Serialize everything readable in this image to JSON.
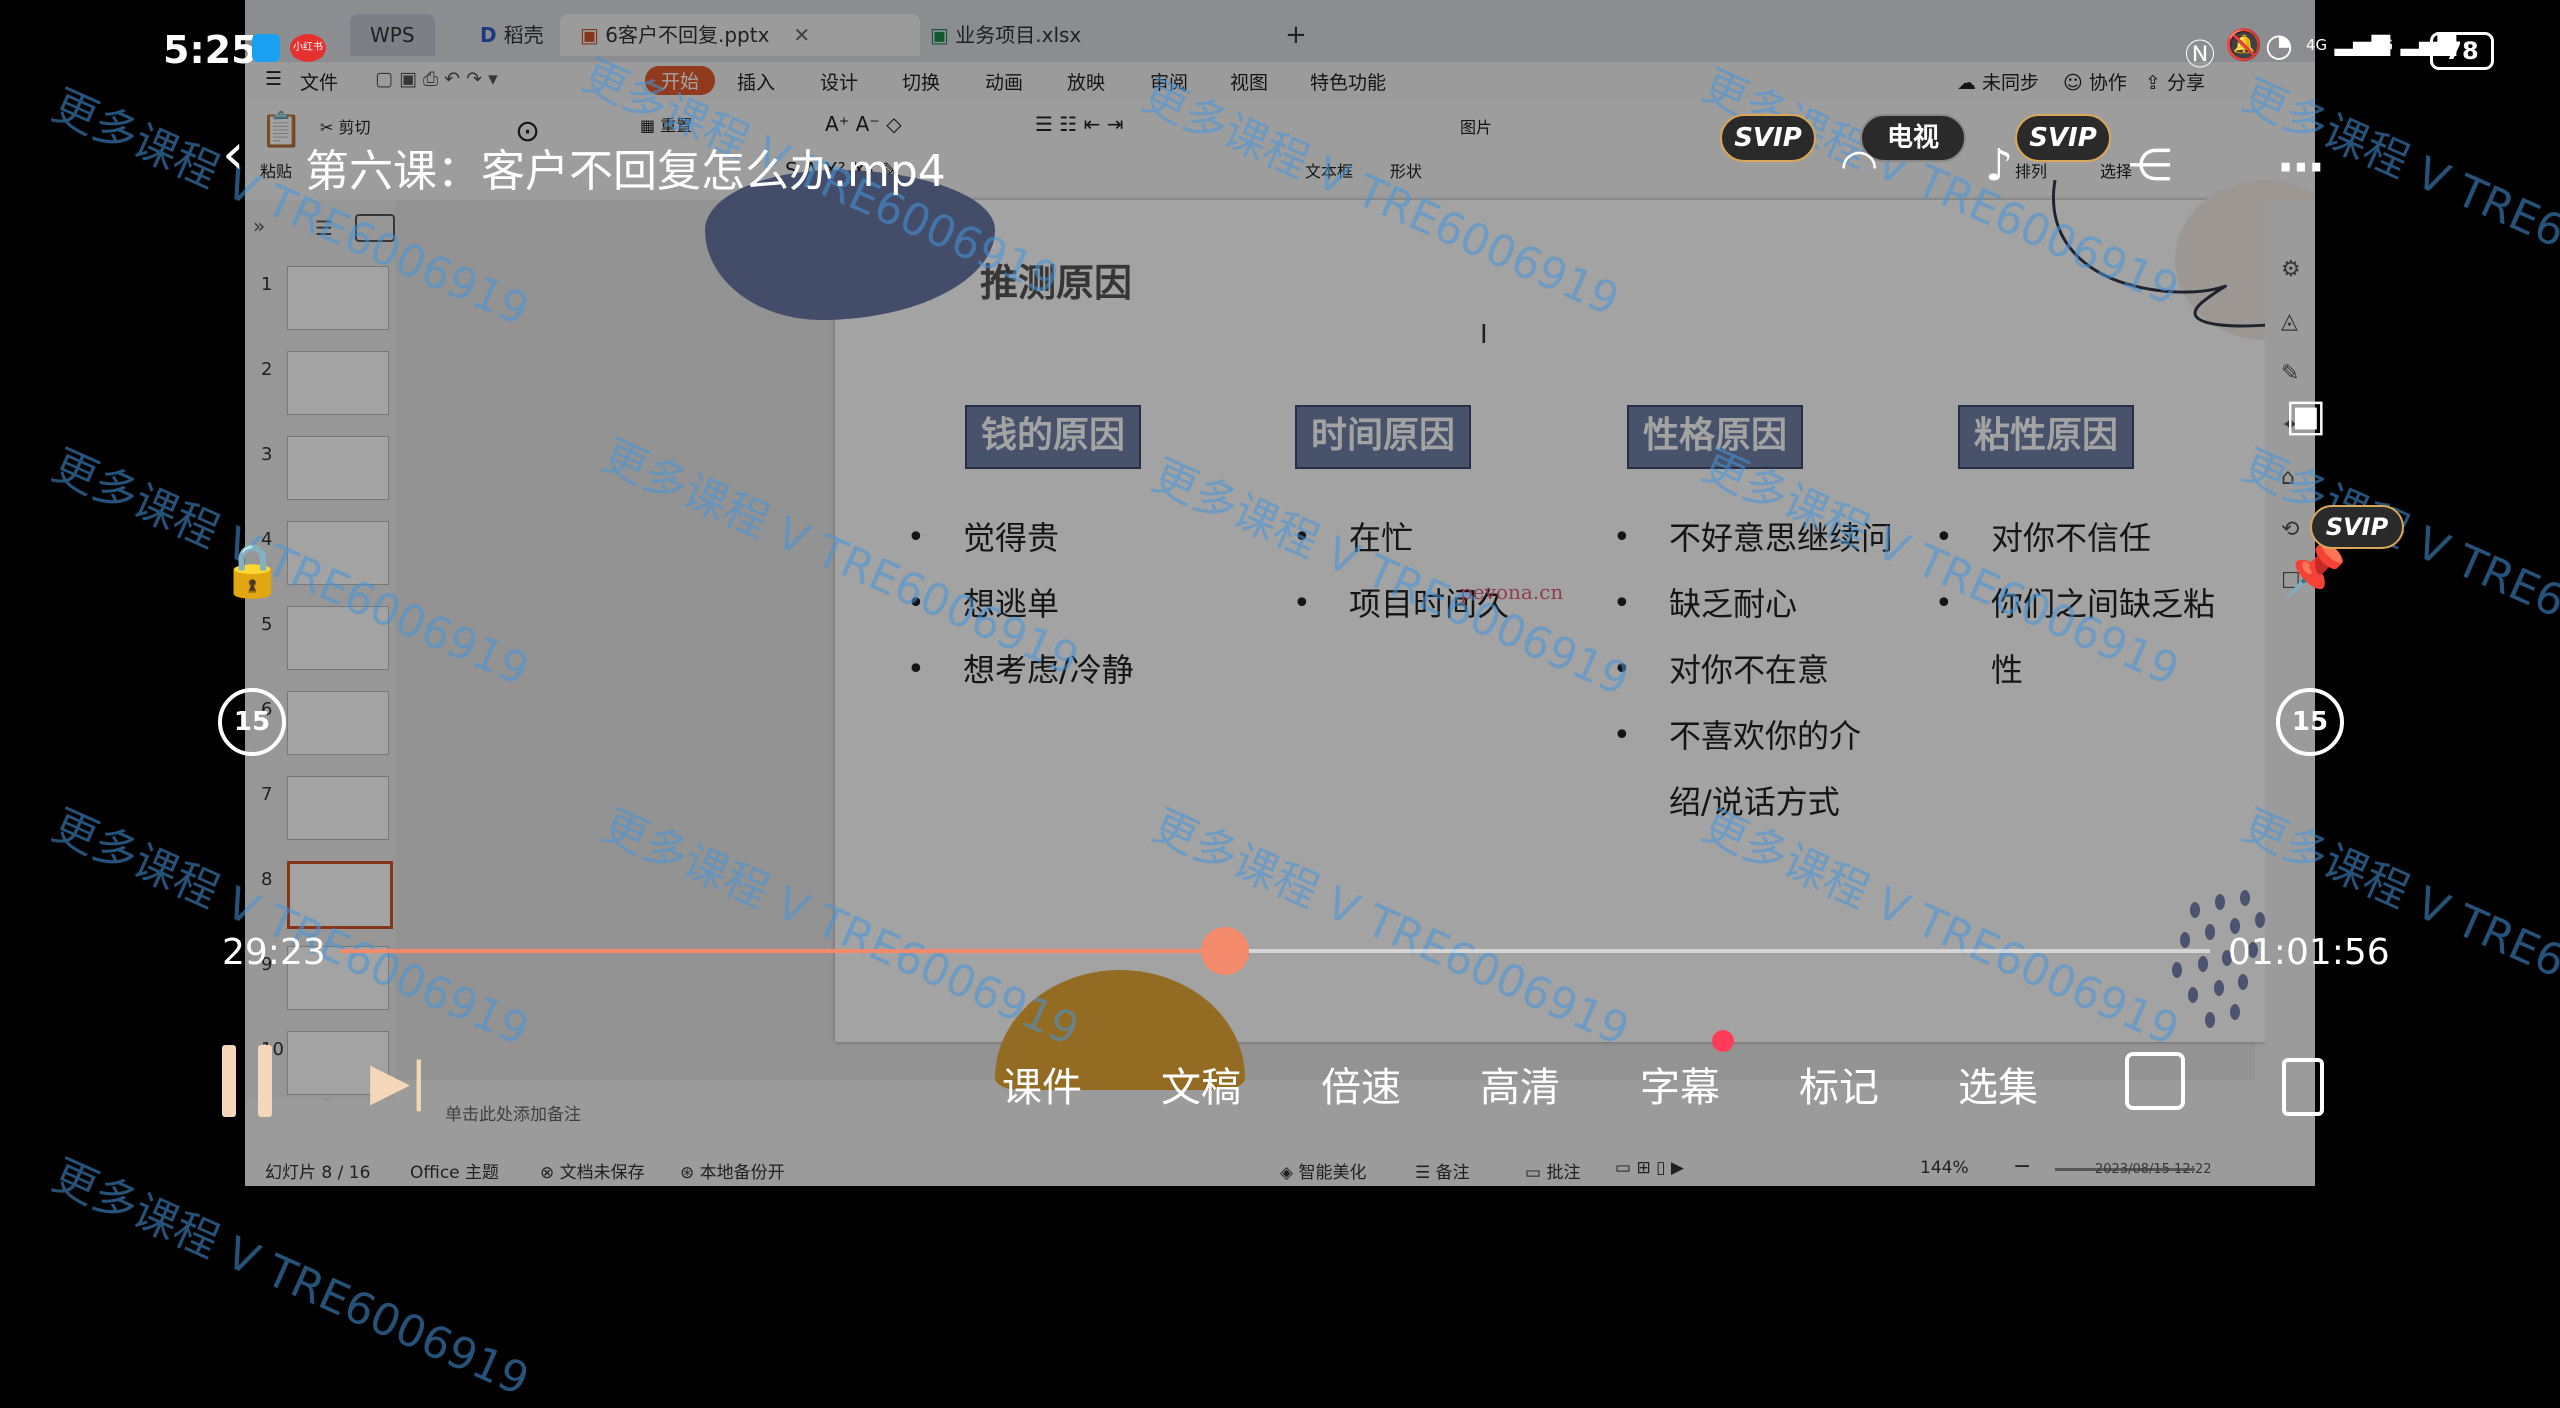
{
  "status_bar": {
    "time": "5:25",
    "battery": "78",
    "app_badge_1": "",
    "app_badge_2": "小红书",
    "net1": "4G",
    "net2": "4G"
  },
  "wps": {
    "tabs": [
      {
        "label": "WPS"
      },
      {
        "label": "稻壳"
      },
      {
        "label": "6客户不回复.pptx"
      },
      {
        "label": "业务项目.xlsx"
      }
    ],
    "menu": {
      "file": "文件",
      "items": [
        "开始",
        "插入",
        "设计",
        "切换",
        "动画",
        "放映",
        "审阅",
        "视图",
        "特色功能"
      ],
      "sync": "未同步",
      "collab": "协作",
      "share": "分享"
    },
    "ribbon": {
      "paste": "粘贴",
      "cut": "剪切",
      "reset": "重置",
      "textbox": "文本框",
      "shape": "形状",
      "select": "选择",
      "image": "图片",
      "sort": "排列"
    },
    "slides": {
      "numbers": [
        "1",
        "2",
        "3",
        "4",
        "5",
        "6",
        "7",
        "8",
        "9",
        "10"
      ],
      "selected": 8,
      "add_label": "+"
    },
    "notes_placeholder": "单击此处添加备注",
    "statusbar": {
      "slide_pos": "幻灯片 8 / 16",
      "theme": "Office 主题",
      "doc_status": "文档未保存",
      "backup": "本地备份开",
      "beautify": "智能美化",
      "notes": "备注",
      "comments": "批注",
      "zoom": "144%",
      "date": "2023/08/15 12:22"
    }
  },
  "slide": {
    "title": "推测原因",
    "watermark_url": "pevona.cn",
    "columns": [
      {
        "heading": "钱的原因",
        "items": [
          "觉得贵",
          "想逃单",
          "想考虑/冷静"
        ]
      },
      {
        "heading": "时间原因",
        "items": [
          "在忙",
          "项目时间久"
        ]
      },
      {
        "heading": "性格原因",
        "items": [
          "不好意思继续问",
          "缺乏耐心",
          "对你不在意",
          "不喜欢你的介绍/说话方式"
        ]
      },
      {
        "heading": "粘性原因",
        "items": [
          "对你不信任",
          "你们之间缺乏粘性"
        ]
      }
    ]
  },
  "player": {
    "title": "第六课：客户不回复怎么办.mp4",
    "current_time": "29:23",
    "total_time": "01:01:56",
    "progress": 0.4734,
    "skip_back": "15",
    "skip_forward": "15",
    "vip_label": "SVIP",
    "tv_label": "电视",
    "bottom_menu": [
      "课件",
      "文稿",
      "倍速",
      "高清",
      "字幕",
      "标记",
      "选集"
    ],
    "watermark_text": "更多课程 V TRE6006919",
    "accent_color": "#f28a6b"
  }
}
